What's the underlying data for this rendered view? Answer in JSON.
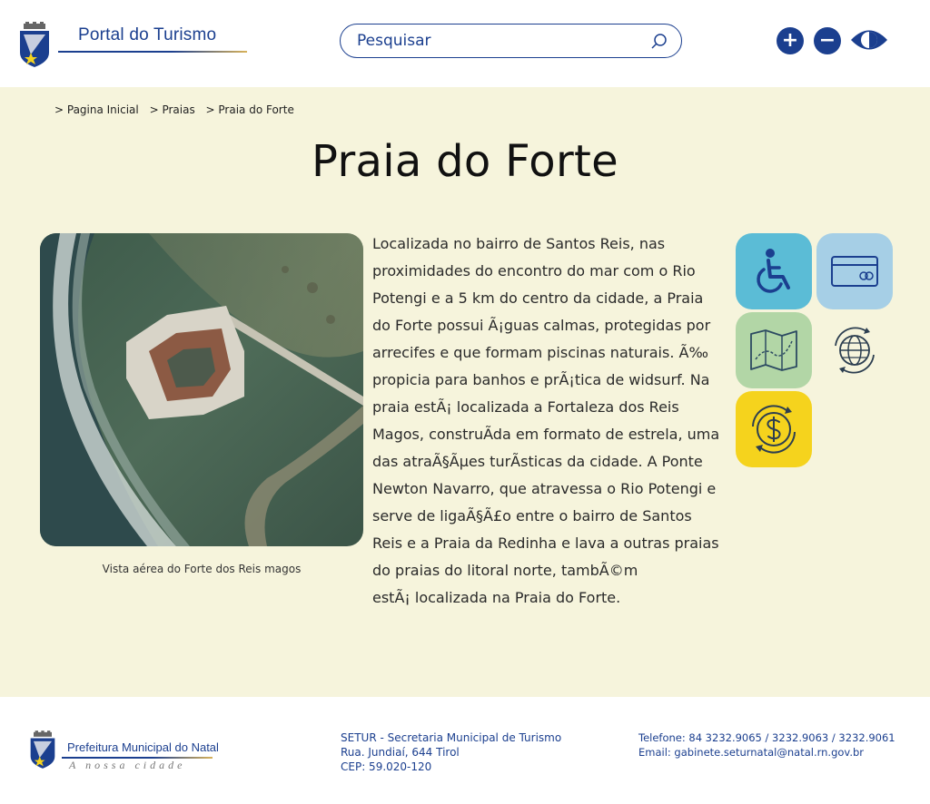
{
  "header": {
    "logo_title": "Portal do Turismo",
    "search": {
      "placeholder": "Pesquisar"
    },
    "zoom_in_label": "+",
    "zoom_out_label": "−"
  },
  "breadcrumb": [
    "> Pagina Inicial",
    "> Praias",
    "> Praia do Forte"
  ],
  "page": {
    "title": "Praia do Forte",
    "photo_caption": "Vista aérea do Forte dos Reis magos",
    "description_lines": [
      "Localizada no bairro de Santos Reis, nas",
      "proximidades do encontro do mar com o Rio",
      "Potengi e a 5 km do centro da cidade, a Praia",
      "do Forte possui Ã¡guas calmas, protegidas por",
      "arrecifes e que formam piscinas naturais. Ã‰",
      "propicia para banhos e prÃ¡tica de widsurf. Na",
      "praia estÃ¡ localizada a Fortaleza dos Reis",
      "Magos, construÃda em formato de estrela, uma",
      "das atraÃ§Ãµes turÃsticas da cidade. A Ponte",
      "Newton Navarro, que atravessa o Rio Potengi e",
      "serve de ligaÃ§Ã£o entre o bairro de Santos",
      "Reis e a Praia da Redinha e lava a outras praias",
      "do praias do litoral norte, tambÃ©m",
      "estÃ¡ localizada na Praia do Forte."
    ]
  },
  "info_icons": [
    "wheelchair-icon",
    "credit-card-icon",
    "map-icon",
    "globe-icon",
    "money-icon"
  ],
  "colors": {
    "primary": "#1b3f8f",
    "background": "#f6f4dc",
    "accessibility_tile": "#5bbcd6",
    "card_tile": "#a6cfe6",
    "map_tile": "#b2d6a6",
    "money_tile": "#f5d31d"
  },
  "footer": {
    "prefeitura_name": "Prefeitura Municipal do Natal",
    "slogan": "A nossa cidade",
    "address_lines": [
      "SETUR - Secretaria Municipal de Turismo",
      "Rua. Jundiaí, 644 Tirol",
      "CEP: 59.020-120"
    ],
    "phone": "Telefone: 84 3232.9065 / 3232.9063 / 3232.9061",
    "email": "Email: gabinete.seturnatal@natal.rn.gov.br"
  }
}
